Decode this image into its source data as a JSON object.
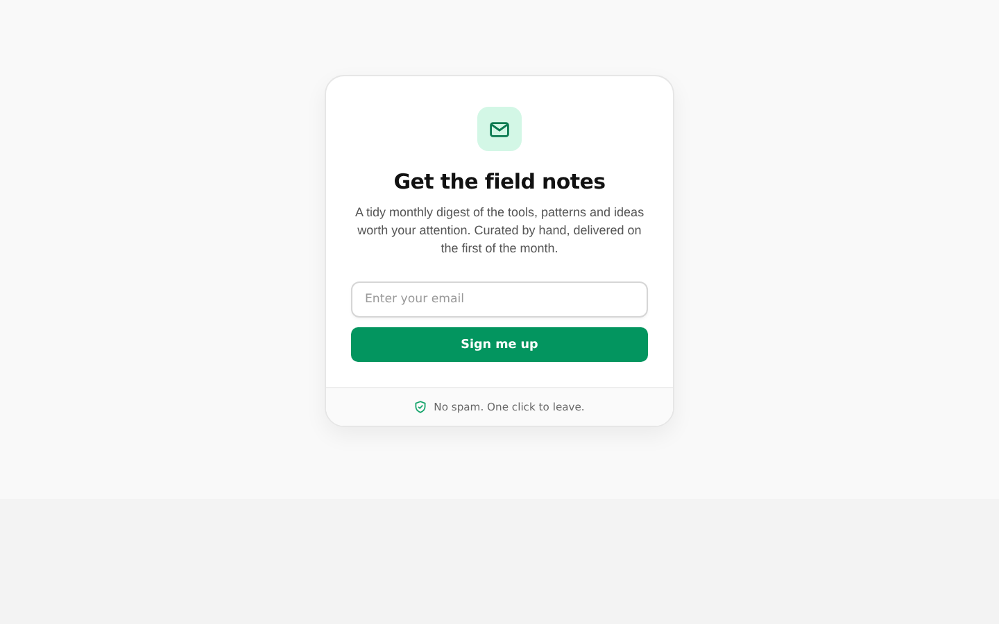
{
  "card": {
    "title": "Get the field notes",
    "description": "A tidy monthly digest of the tools, patterns and ideas worth your attention. Curated by hand, delivered on the first of the month.",
    "email_field": {
      "placeholder": "Enter your email"
    },
    "submit_button": "Sign me up",
    "footer_note": "No spam. One click to leave."
  }
}
